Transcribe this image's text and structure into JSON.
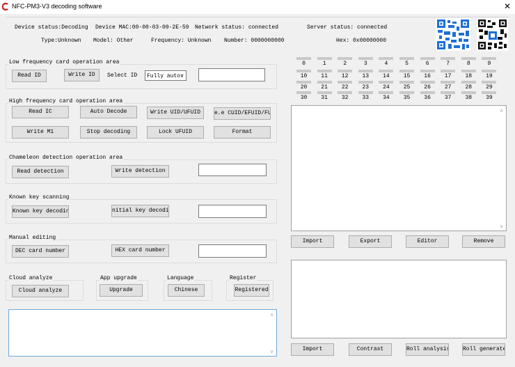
{
  "window": {
    "title": "NFC-PM3-V3 decoding software",
    "close_glyph": "✕",
    "accent": "#c62828"
  },
  "status": {
    "device_status": "Device status:Decoding",
    "device_mac": "Device MAC:00-00-03-00-2E-59",
    "network_status": "Network status: connected",
    "server_status": "Server status: connected",
    "type": "Type:Unknown",
    "model": "Model: Other",
    "frequency": "Frequency: Unknown",
    "number": "Number: 0000000000",
    "hex": "Hex: 0x00000000"
  },
  "low_freq": {
    "title": "Low frequency card operation area",
    "read_id": "Read ID",
    "write_id": "Write ID",
    "select_label": "Select ID",
    "select_value": "Fully auto",
    "select_arrow": "∨"
  },
  "high_freq": {
    "title": "High frequency card operation area",
    "read_ic": "Read IC",
    "auto_decode": "Auto Decode",
    "write_uid": "Write UID/UFUID",
    "write_cuid": "e.e CUID/EFUID/FUID",
    "write_m1": "Write M1",
    "stop_decoding": "Stop decoding",
    "lock_ufuid": "Lock UFUID",
    "format": "Format"
  },
  "chameleon": {
    "title": "Chameleon detection operation area",
    "read_detection": "Read detection",
    "write_detection": "Write detection"
  },
  "known_key": {
    "title": "Known key scanning",
    "known_key_decoding": "Known key decoding",
    "initial_key_decoding": "nitial key decoding"
  },
  "manual": {
    "title": "Manual editing",
    "dec_card_number": "DEC card number",
    "hex_card_number": "HEX card number"
  },
  "cloud": {
    "title": "Cloud analyze",
    "button": "Cloud analyze"
  },
  "app_upgrade": {
    "title": "App upgrade",
    "button": "Upgrade"
  },
  "language": {
    "title": "Language",
    "button": "Chinese"
  },
  "register": {
    "title": "Register",
    "button": "Registered"
  },
  "sectors": {
    "row1": [
      "0",
      "1",
      "2",
      "3",
      "4",
      "5",
      "6",
      "7",
      "8",
      "9"
    ],
    "row2": [
      "10",
      "11",
      "12",
      "13",
      "14",
      "15",
      "16",
      "17",
      "18",
      "19"
    ],
    "row3": [
      "20",
      "21",
      "22",
      "23",
      "24",
      "25",
      "26",
      "27",
      "28",
      "29"
    ],
    "row4": [
      "30",
      "31",
      "32",
      "33",
      "34",
      "35",
      "36",
      "37",
      "38",
      "39"
    ]
  },
  "data_buttons": {
    "import": "Import",
    "export": "Export",
    "editor": "Editor",
    "remove": "Remove"
  },
  "bottom_buttons": {
    "import": "Import",
    "contrast": "Contrast",
    "roll_analysis": "Roll analysis",
    "roll_generate": "Roll generate"
  },
  "scroll": {
    "up": "∧",
    "down": "∨"
  }
}
